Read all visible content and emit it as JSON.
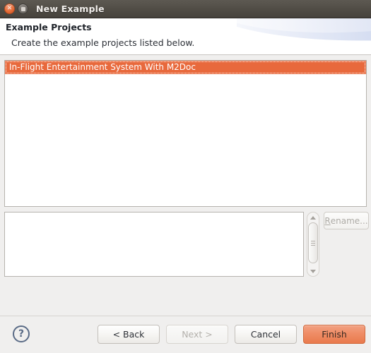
{
  "window": {
    "title": "New Example",
    "controls": {
      "close_icon": "close-circle-icon",
      "maximize_icon": "maximize-circle-icon"
    }
  },
  "header": {
    "title": "Example Projects",
    "subtitle": "Create the example projects listed below."
  },
  "project_list": {
    "items": [
      {
        "label": "In-Flight Entertainment System With M2Doc",
        "selected": true
      }
    ]
  },
  "description": {
    "value": "",
    "placeholder": ""
  },
  "scrollbar": {
    "up_icon": "scroll-up-arrow-icon",
    "down_icon": "scroll-down-arrow-icon",
    "grip_icon": "scrollbar-grip-icon"
  },
  "side_actions": {
    "rename_mnemonic": "R",
    "rename_label": "ename...",
    "rename_enabled": false
  },
  "footer": {
    "help_icon": "help-question-icon",
    "buttons": [
      {
        "label": "< Back",
        "name": "back-button",
        "state": "enabled"
      },
      {
        "label": "Next >",
        "name": "next-button",
        "state": "disabled"
      },
      {
        "label": "Cancel",
        "name": "cancel-button",
        "state": "enabled"
      },
      {
        "label": "Finish",
        "name": "finish-button",
        "state": "default"
      }
    ]
  },
  "colors": {
    "titlebar": "#514d46",
    "selection": "#e8693c",
    "primary_button": "#ef8d66",
    "help_icon": "#5a6b86"
  }
}
